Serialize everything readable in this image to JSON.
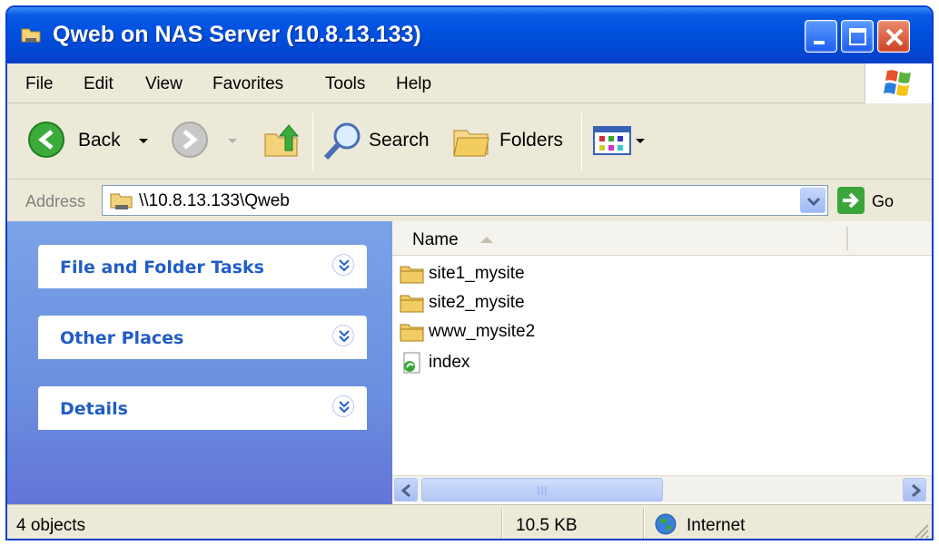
{
  "window": {
    "title": "Qweb on NAS Server (10.8.13.133)"
  },
  "menubar": {
    "items": [
      "File",
      "Edit",
      "View",
      "Favorites",
      "Tools",
      "Help"
    ]
  },
  "toolbar": {
    "back_label": "Back",
    "search_label": "Search",
    "folders_label": "Folders"
  },
  "address": {
    "label": "Address",
    "value": "\\\\10.8.13.133\\Qweb",
    "go_label": "Go"
  },
  "taskpane": {
    "sections": [
      "File and Folder Tasks",
      "Other Places",
      "Details"
    ]
  },
  "filelist": {
    "column_name": "Name",
    "items": [
      {
        "name": "site1_mysite",
        "icon": "folder-icon"
      },
      {
        "name": "site2_mysite",
        "icon": "folder-icon"
      },
      {
        "name": "www_mysite2",
        "icon": "folder-icon"
      },
      {
        "name": "index",
        "icon": "web-page-icon"
      }
    ]
  },
  "statusbar": {
    "objects": "4 objects",
    "size": "10.5 KB",
    "zone": "Internet"
  },
  "colors": {
    "titlebar": "#0052e0",
    "taskpane": "#6b8fe0",
    "task_title": "#215dc6"
  }
}
